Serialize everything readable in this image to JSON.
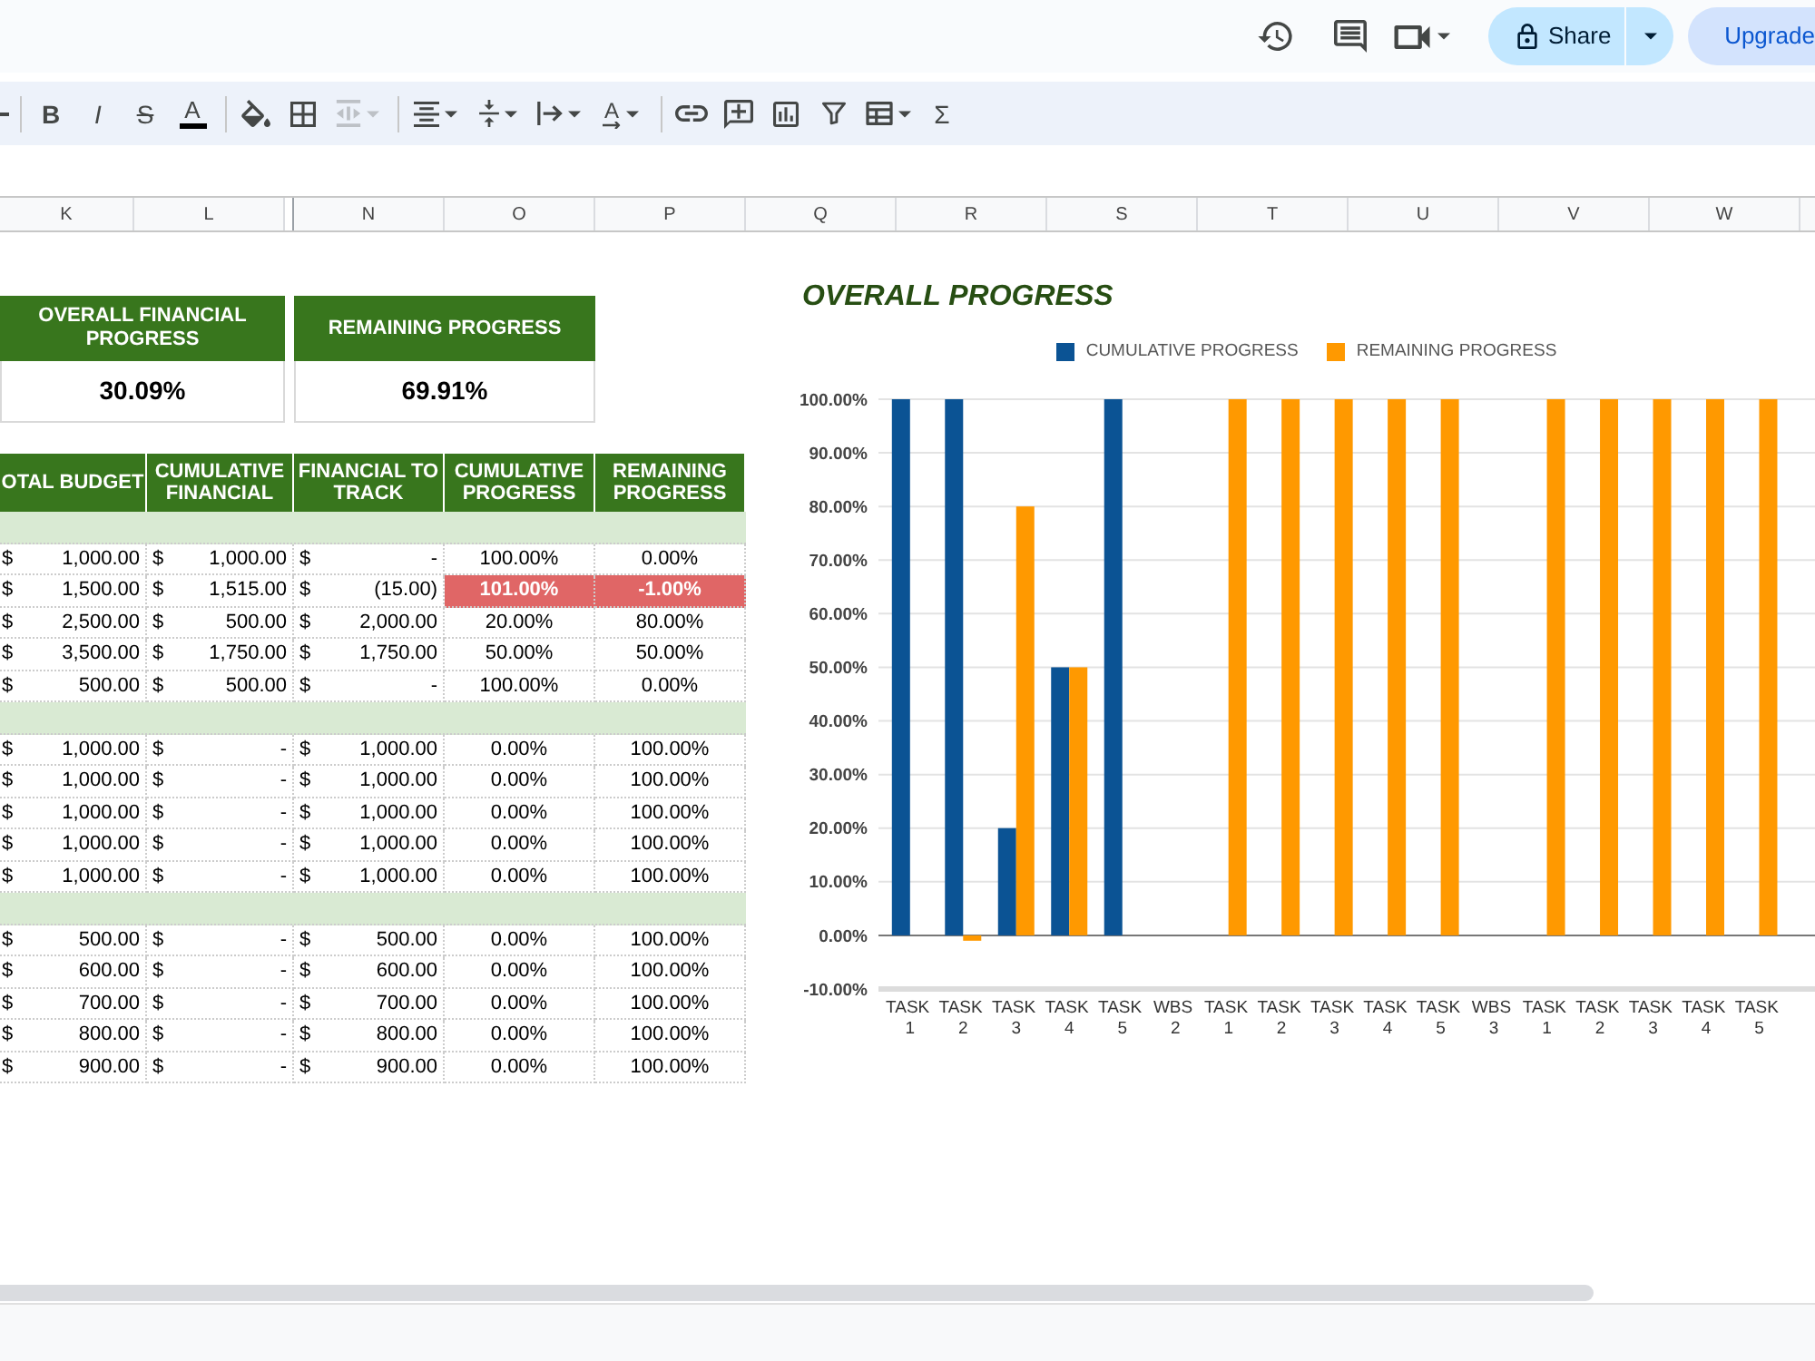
{
  "top_bar": {
    "share_button": "Share",
    "upgrade_button": "Upgrade"
  },
  "toolbar": {
    "bold": "B",
    "italic": "I",
    "strikethrough": "S",
    "text_color": "A",
    "text_rotation": "A",
    "functions": "Σ",
    "merge_cells": {
      "disabled": true
    }
  },
  "column_headers": [
    {
      "label": "K",
      "hidden_before": false
    },
    {
      "label": "L",
      "hidden_before": false
    },
    {
      "label": "N",
      "hidden_before": true
    },
    {
      "label": "O",
      "hidden_before": false
    },
    {
      "label": "P",
      "hidden_before": false
    },
    {
      "label": "Q",
      "hidden_before": false
    },
    {
      "label": "R",
      "hidden_before": false
    },
    {
      "label": "S",
      "hidden_before": false
    },
    {
      "label": "T",
      "hidden_before": false
    },
    {
      "label": "U",
      "hidden_before": false
    },
    {
      "label": "V",
      "hidden_before": false
    },
    {
      "label": "W",
      "hidden_before": false
    }
  ],
  "summary_cards": [
    {
      "title": "OVERALL FINANCIAL PROGRESS",
      "value": "30.09%"
    },
    {
      "title": "REMAINING PROGRESS",
      "value": "69.91%"
    }
  ],
  "table": {
    "columns": [
      "OTAL BUDGET",
      "CUMULATIVE FINANCIAL",
      "FINANCIAL TO TRACK",
      "CUMULATIVE PROGRESS",
      "REMAINING PROGRESS"
    ],
    "rows": [
      {
        "kind": "group",
        "flagged": false
      },
      {
        "kind": "task",
        "flagged": false,
        "cells": [
          {
            "currency": "$",
            "amount": "1,000.00"
          },
          {
            "currency": "$",
            "amount": "1,000.00"
          },
          {
            "currency": "$",
            "amount": "-"
          },
          {
            "text": "100.00%"
          },
          {
            "text": "0.00%"
          }
        ]
      },
      {
        "kind": "task",
        "flagged": true,
        "cells": [
          {
            "currency": "$",
            "amount": "1,500.00"
          },
          {
            "currency": "$",
            "amount": "1,515.00"
          },
          {
            "currency": "$",
            "amount": "(15.00)"
          },
          {
            "text": "101.00%"
          },
          {
            "text": "-1.00%"
          }
        ]
      },
      {
        "kind": "task",
        "flagged": false,
        "cells": [
          {
            "currency": "$",
            "amount": "2,500.00"
          },
          {
            "currency": "$",
            "amount": "500.00"
          },
          {
            "currency": "$",
            "amount": "2,000.00"
          },
          {
            "text": "20.00%"
          },
          {
            "text": "80.00%"
          }
        ]
      },
      {
        "kind": "task",
        "flagged": false,
        "cells": [
          {
            "currency": "$",
            "amount": "3,500.00"
          },
          {
            "currency": "$",
            "amount": "1,750.00"
          },
          {
            "currency": "$",
            "amount": "1,750.00"
          },
          {
            "text": "50.00%"
          },
          {
            "text": "50.00%"
          }
        ]
      },
      {
        "kind": "task",
        "flagged": false,
        "cells": [
          {
            "currency": "$",
            "amount": "500.00"
          },
          {
            "currency": "$",
            "amount": "500.00"
          },
          {
            "currency": "$",
            "amount": "-"
          },
          {
            "text": "100.00%"
          },
          {
            "text": "0.00%"
          }
        ]
      },
      {
        "kind": "group",
        "flagged": false
      },
      {
        "kind": "task",
        "flagged": false,
        "cells": [
          {
            "currency": "$",
            "amount": "1,000.00"
          },
          {
            "currency": "$",
            "amount": "-"
          },
          {
            "currency": "$",
            "amount": "1,000.00"
          },
          {
            "text": "0.00%"
          },
          {
            "text": "100.00%"
          }
        ]
      },
      {
        "kind": "task",
        "flagged": false,
        "cells": [
          {
            "currency": "$",
            "amount": "1,000.00"
          },
          {
            "currency": "$",
            "amount": "-"
          },
          {
            "currency": "$",
            "amount": "1,000.00"
          },
          {
            "text": "0.00%"
          },
          {
            "text": "100.00%"
          }
        ]
      },
      {
        "kind": "task",
        "flagged": false,
        "cells": [
          {
            "currency": "$",
            "amount": "1,000.00"
          },
          {
            "currency": "$",
            "amount": "-"
          },
          {
            "currency": "$",
            "amount": "1,000.00"
          },
          {
            "text": "0.00%"
          },
          {
            "text": "100.00%"
          }
        ]
      },
      {
        "kind": "task",
        "flagged": false,
        "cells": [
          {
            "currency": "$",
            "amount": "1,000.00"
          },
          {
            "currency": "$",
            "amount": "-"
          },
          {
            "currency": "$",
            "amount": "1,000.00"
          },
          {
            "text": "0.00%"
          },
          {
            "text": "100.00%"
          }
        ]
      },
      {
        "kind": "task",
        "flagged": false,
        "cells": [
          {
            "currency": "$",
            "amount": "1,000.00"
          },
          {
            "currency": "$",
            "amount": "-"
          },
          {
            "currency": "$",
            "amount": "1,000.00"
          },
          {
            "text": "0.00%"
          },
          {
            "text": "100.00%"
          }
        ]
      },
      {
        "kind": "group",
        "flagged": false
      },
      {
        "kind": "task",
        "flagged": false,
        "cells": [
          {
            "currency": "$",
            "amount": "500.00"
          },
          {
            "currency": "$",
            "amount": "-"
          },
          {
            "currency": "$",
            "amount": "500.00"
          },
          {
            "text": "0.00%"
          },
          {
            "text": "100.00%"
          }
        ]
      },
      {
        "kind": "task",
        "flagged": false,
        "cells": [
          {
            "currency": "$",
            "amount": "600.00"
          },
          {
            "currency": "$",
            "amount": "-"
          },
          {
            "currency": "$",
            "amount": "600.00"
          },
          {
            "text": "0.00%"
          },
          {
            "text": "100.00%"
          }
        ]
      },
      {
        "kind": "task",
        "flagged": false,
        "cells": [
          {
            "currency": "$",
            "amount": "700.00"
          },
          {
            "currency": "$",
            "amount": "-"
          },
          {
            "currency": "$",
            "amount": "700.00"
          },
          {
            "text": "0.00%"
          },
          {
            "text": "100.00%"
          }
        ]
      },
      {
        "kind": "task",
        "flagged": false,
        "cells": [
          {
            "currency": "$",
            "amount": "800.00"
          },
          {
            "currency": "$",
            "amount": "-"
          },
          {
            "currency": "$",
            "amount": "800.00"
          },
          {
            "text": "0.00%"
          },
          {
            "text": "100.00%"
          }
        ]
      },
      {
        "kind": "task",
        "flagged": false,
        "cells": [
          {
            "currency": "$",
            "amount": "900.00"
          },
          {
            "currency": "$",
            "amount": "-"
          },
          {
            "currency": "$",
            "amount": "900.00"
          },
          {
            "text": "0.00%"
          },
          {
            "text": "100.00%"
          }
        ]
      }
    ]
  },
  "chart": {
    "chart_data": {
      "type": "bar",
      "title": "OVERALL PROGRESS",
      "categories": [
        "TASK 1",
        "TASK 2",
        "TASK 3",
        "TASK 4",
        "TASK 5",
        "WBS 2",
        "TASK 1",
        "TASK 2",
        "TASK 3",
        "TASK 4",
        "TASK 5",
        "WBS 3",
        "TASK 1",
        "TASK 2",
        "TASK 3",
        "TASK 4",
        "TASK 5"
      ],
      "series": [
        {
          "name": "CUMULATIVE PROGRESS",
          "color": "#0b5394",
          "values": [
            100,
            100,
            20,
            50,
            100,
            null,
            0,
            0,
            0,
            0,
            0,
            null,
            0,
            0,
            0,
            0,
            0
          ]
        },
        {
          "name": "REMAINING PROGRESS",
          "color": "#ff9900",
          "values": [
            0,
            -1,
            80,
            50,
            0,
            null,
            100,
            100,
            100,
            100,
            100,
            null,
            100,
            100,
            100,
            100,
            100
          ]
        }
      ],
      "legend": true,
      "grid": true,
      "ylim": [
        -10,
        100
      ],
      "yticks": [
        {
          "value": -10,
          "label": "-10.00%"
        },
        {
          "value": 0,
          "label": "0.00%"
        },
        {
          "value": 10,
          "label": "10.00%"
        },
        {
          "value": 20,
          "label": "20.00%"
        },
        {
          "value": 30,
          "label": "30.00%"
        },
        {
          "value": 40,
          "label": "40.00%"
        },
        {
          "value": 50,
          "label": "50.00%"
        },
        {
          "value": 60,
          "label": "60.00%"
        },
        {
          "value": 70,
          "label": "70.00%"
        },
        {
          "value": 80,
          "label": "80.00%"
        },
        {
          "value": 90,
          "label": "90.00%"
        },
        {
          "value": 100,
          "label": "100.00%"
        }
      ]
    }
  }
}
